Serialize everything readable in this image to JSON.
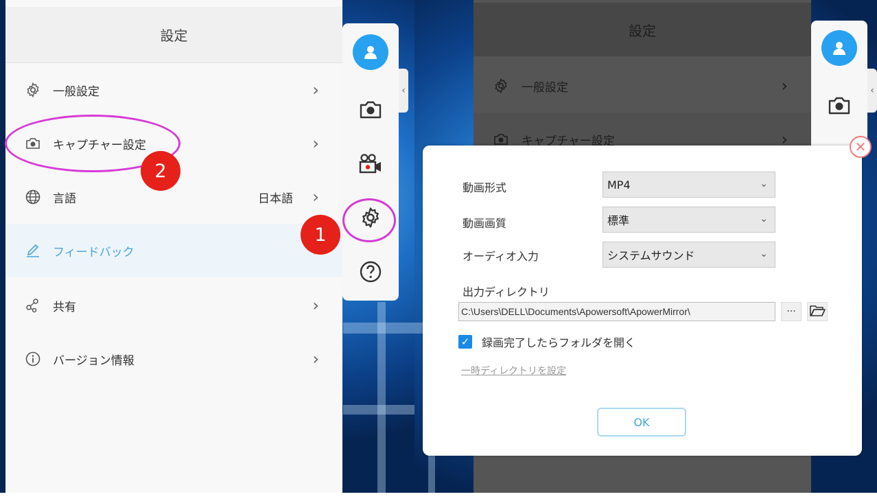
{
  "left": {
    "settings": {
      "title": "設定",
      "items": [
        {
          "icon": "gear-icon",
          "label": "一般設定",
          "value": ""
        },
        {
          "icon": "camera-icon",
          "label": "キャプチャー設定",
          "value": ""
        },
        {
          "icon": "globe-icon",
          "label": "言語",
          "value": "日本語"
        },
        {
          "icon": "pencil-icon",
          "label": "フィードバック",
          "value": ""
        },
        {
          "icon": "share-icon",
          "label": "共有",
          "value": ""
        },
        {
          "icon": "info-icon",
          "label": "バージョン情報",
          "value": ""
        }
      ],
      "chevron": "›"
    },
    "toolbar": {
      "buttons": [
        "user-avatar-icon",
        "camera-icon",
        "video-camera-icon",
        "gear-icon",
        "help-icon"
      ],
      "collapse": "‹"
    },
    "annotations": {
      "step1": "1",
      "step2": "2"
    }
  },
  "right": {
    "background_app": {
      "title": "設定",
      "items": [
        "一般設定",
        "キャプチャー設定"
      ]
    },
    "dialog": {
      "video_format_label": "動画形式",
      "video_format_value": "MP4",
      "video_quality_label": "動画画質",
      "video_quality_value": "標準",
      "audio_input_label": "オーディオ入力",
      "audio_input_value": "システムサウンド",
      "output_dir_label": "出力ディレクトリ",
      "output_dir_value": "C:\\Users\\DELL\\Documents\\Apowersoft\\ApowerMirror\\",
      "browse_label": "···",
      "open_folder_checkbox_label": "録画完了したらフォルダを開く",
      "open_folder_checked": true,
      "temp_dir_link": "一時ディレクトリを設定",
      "ok_label": "OK"
    }
  },
  "colors": {
    "accent_blue": "#29a1f1",
    "active_text": "#4aa4dc",
    "annotation_magenta": "#d63ad6",
    "badge_red": "#e6211a",
    "close_red": "#f07a7a"
  }
}
